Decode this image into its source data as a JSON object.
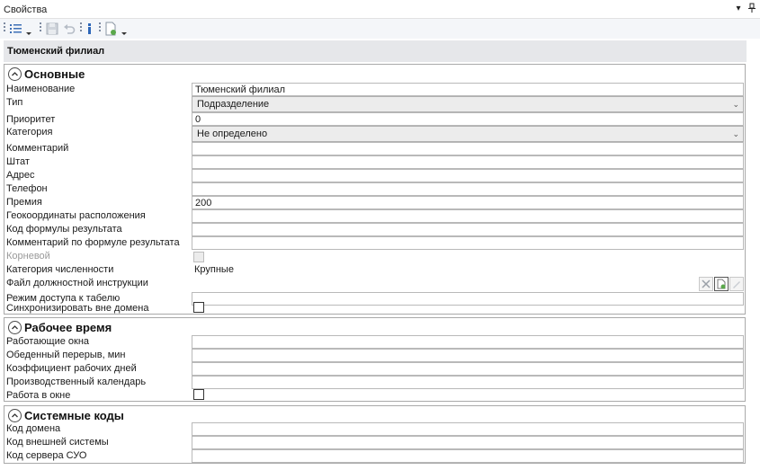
{
  "window": {
    "title": "Свойства",
    "pin_glyph": "▾",
    "pushpin_glyph": "ᵾ"
  },
  "toolbar": {
    "icons": [
      "list-icon",
      "save-icon",
      "undo-icon",
      "info-icon",
      "new-document-icon"
    ]
  },
  "header": {
    "title": "Тюменский филиал"
  },
  "groups": {
    "basic": {
      "title": "Основные",
      "rows": [
        {
          "label": "Наименование",
          "value": "Тюменский филиал"
        },
        {
          "label": "Тип",
          "value": "Подразделение"
        },
        {
          "label": "Приоритет",
          "value": "0"
        },
        {
          "label": "Категория",
          "value": "Не определено"
        },
        {
          "label": "Комментарий",
          "value": ""
        },
        {
          "label": "Штат",
          "value": ""
        },
        {
          "label": "Адрес",
          "value": ""
        },
        {
          "label": "Телефон",
          "value": ""
        },
        {
          "label": "Премия",
          "value": "200"
        },
        {
          "label": "Геокоординаты расположения",
          "value": ""
        },
        {
          "label": "Код формулы результата",
          "value": ""
        },
        {
          "label": "Комментарий по формуле результата",
          "value": ""
        },
        {
          "label": "Корневой",
          "value": ""
        },
        {
          "label": "Категория численности",
          "value": "Крупные"
        },
        {
          "label": "Файл должностной инструкции",
          "value": ""
        },
        {
          "label": "Режим доступа к табелю",
          "value": ""
        },
        {
          "label": "Синхронизировать вне домена",
          "value": ""
        }
      ]
    },
    "worktime": {
      "title": "Рабочее время",
      "rows": [
        {
          "label": "Работающие окна",
          "value": ""
        },
        {
          "label": "Обеденный перерыв, мин",
          "value": ""
        },
        {
          "label": "Коэффициент рабочих дней",
          "value": ""
        },
        {
          "label": "Производственный календарь",
          "value": ""
        },
        {
          "label": "Работа в окне",
          "value": ""
        }
      ]
    },
    "syscodes": {
      "title": "Системные коды",
      "rows": [
        {
          "label": "Код домена",
          "value": ""
        },
        {
          "label": "Код внешней системы",
          "value": ""
        },
        {
          "label": "Код сервера СУО",
          "value": ""
        }
      ]
    }
  },
  "combo_arrow": "⌄"
}
